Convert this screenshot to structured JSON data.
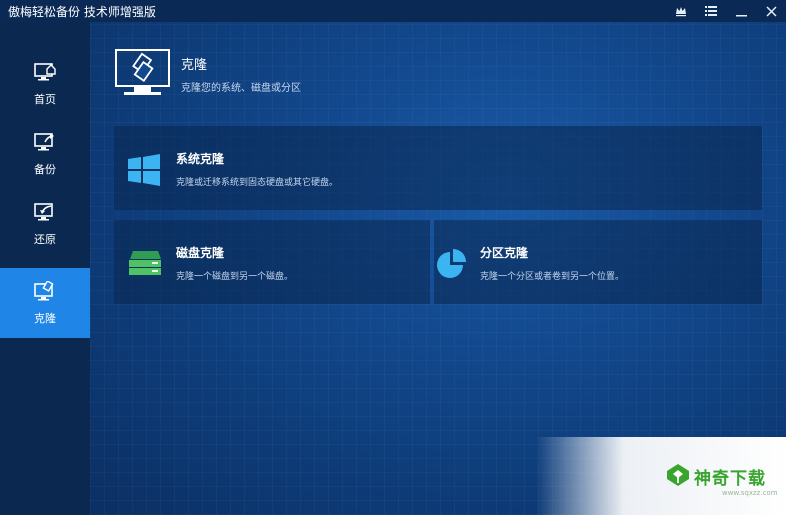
{
  "app": {
    "title": "傲梅轻松备份 技术师增强版"
  },
  "window_controls": [
    {
      "name": "upgrade-icon"
    },
    {
      "name": "menu-icon"
    },
    {
      "name": "minimize-icon"
    },
    {
      "name": "close-icon"
    }
  ],
  "sidebar": {
    "items": [
      {
        "label": "首页",
        "icon": "home-monitor-icon",
        "active": false
      },
      {
        "label": "备份",
        "icon": "backup-monitor-icon",
        "active": false
      },
      {
        "label": "还原",
        "icon": "restore-monitor-icon",
        "active": false
      },
      {
        "label": "克隆",
        "icon": "clone-monitor-icon",
        "active": true
      }
    ],
    "active_color": "#1f86e8"
  },
  "header": {
    "title": "克隆",
    "subtitle": "克隆您的系统、磁盘或分区",
    "icon": "clone-monitor-icon"
  },
  "cards": {
    "system_clone": {
      "title": "系统克隆",
      "desc": "克隆或迁移系统到固态硬盘或其它硬盘。",
      "icon": "windows-icon"
    },
    "disk_clone": {
      "title": "磁盘克隆",
      "desc": "克隆一个磁盘到另一个磁盘。",
      "icon": "disk-icon"
    },
    "partition_clone": {
      "title": "分区克隆",
      "desc": "克隆一个分区或者卷到另一个位置。",
      "icon": "partition-pie-icon"
    }
  },
  "watermark": {
    "text": "神奇下载",
    "url": "www.sqxzz.com"
  }
}
